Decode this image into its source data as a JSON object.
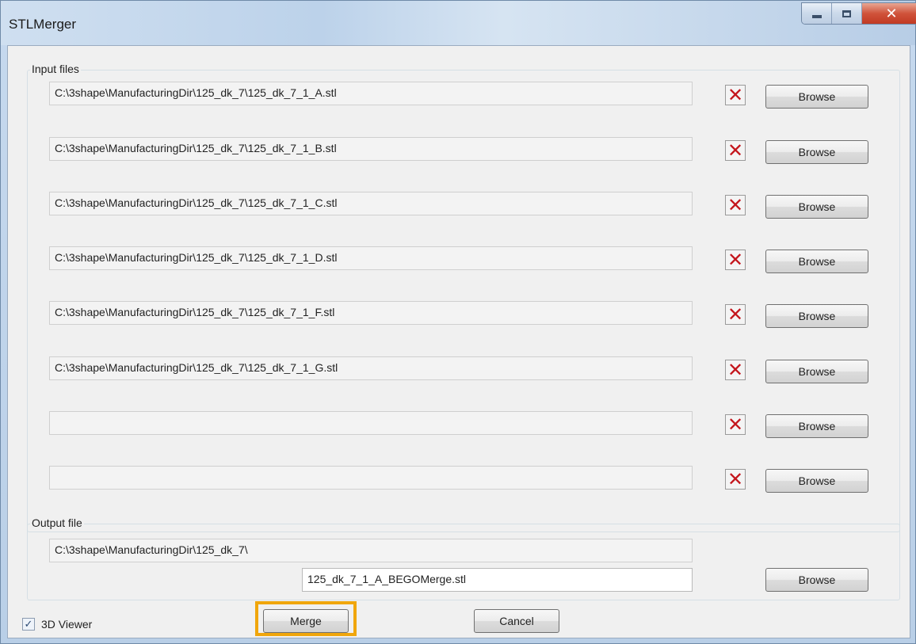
{
  "window": {
    "title": "STLMerger"
  },
  "input_group": {
    "label": "Input files",
    "rows": [
      {
        "path": "C:\\3shape\\ManufacturingDir\\125_dk_7\\125_dk_7_1_A.stl",
        "browse_label": "Browse"
      },
      {
        "path": "C:\\3shape\\ManufacturingDir\\125_dk_7\\125_dk_7_1_B.stl",
        "browse_label": "Browse"
      },
      {
        "path": "C:\\3shape\\ManufacturingDir\\125_dk_7\\125_dk_7_1_C.stl",
        "browse_label": "Browse"
      },
      {
        "path": "C:\\3shape\\ManufacturingDir\\125_dk_7\\125_dk_7_1_D.stl",
        "browse_label": "Browse"
      },
      {
        "path": "C:\\3shape\\ManufacturingDir\\125_dk_7\\125_dk_7_1_F.stl",
        "browse_label": "Browse"
      },
      {
        "path": "C:\\3shape\\ManufacturingDir\\125_dk_7\\125_dk_7_1_G.stl",
        "browse_label": "Browse"
      },
      {
        "path": "",
        "browse_label": "Browse"
      },
      {
        "path": "",
        "browse_label": "Browse"
      }
    ]
  },
  "output_group": {
    "label": "Output file",
    "directory": "C:\\3shape\\ManufacturingDir\\125_dk_7\\",
    "filename": "125_dk_7_1_A_BEGOMerge.stl",
    "browse_label": "Browse"
  },
  "footer": {
    "viewer_checkbox_label": "3D Viewer",
    "viewer_checked": true,
    "merge_label": "Merge",
    "cancel_label": "Cancel"
  },
  "colors": {
    "highlight": "#f0a60c",
    "delete_icon": "#c4151c"
  }
}
